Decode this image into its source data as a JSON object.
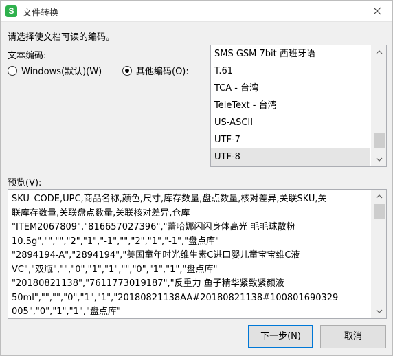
{
  "window": {
    "app_icon_text": "S",
    "title": "文件转换"
  },
  "instruction": "请选择使文档可读的编码。",
  "encoding_label": "文本编码:",
  "radios": {
    "windows_label": "Windows(默认)(W)",
    "windows_checked": false,
    "other_label": "其他编码(O):",
    "other_checked": true
  },
  "encoding_list": {
    "items": [
      "SMS GSM 7bit 西班牙语",
      "T.61",
      "TCA - 台湾",
      "TeleText - 台湾",
      "US-ASCII",
      "UTF-7",
      "UTF-8"
    ],
    "selected": "UTF-8"
  },
  "preview_label": "预览(V):",
  "preview_lines": [
    "SKU_CODE,UPC,商品名称,颜色,尺寸,库存数量,盘点数量,核对差异,关联SKU,关",
    "联库存数量,关联盘点数量,关联核对差异,仓库",
    "\"ITEM2067809\",\"816657027396\",\"蕾哈娜闪闪身体高光 毛毛球散粉",
    "10.5g\",\"\",\"\",\"2\",\"1\",\"-1\",\"\",\"2\",\"1\",\"-1\",\"盘点库\"",
    "\"2894194-A\",\"2894194\",\"美国童年时光维生素C进口婴儿童宝宝维C液",
    "VC\",\"双瓶\",\"\",\"0\",\"1\",\"1\",\"\",\"0\",\"1\",\"1\",\"盘点库\"",
    "\"20180821138\",\"7611773019187\",\"反重力 鱼子精华紧致紧颜液",
    "50ml\",\"\",\"\",\"0\",\"1\",\"1\",\"20180821138AA#20180821138#100801690329",
    "005\",\"0\",\"1\",\"1\",\"盘点库\""
  ],
  "buttons": {
    "next_label": "下一步(N)",
    "cancel_label": "取消"
  },
  "colors": {
    "accent": "#0078d7",
    "app_icon": "#2fb14d",
    "selected_item": "#e5e5e5"
  }
}
